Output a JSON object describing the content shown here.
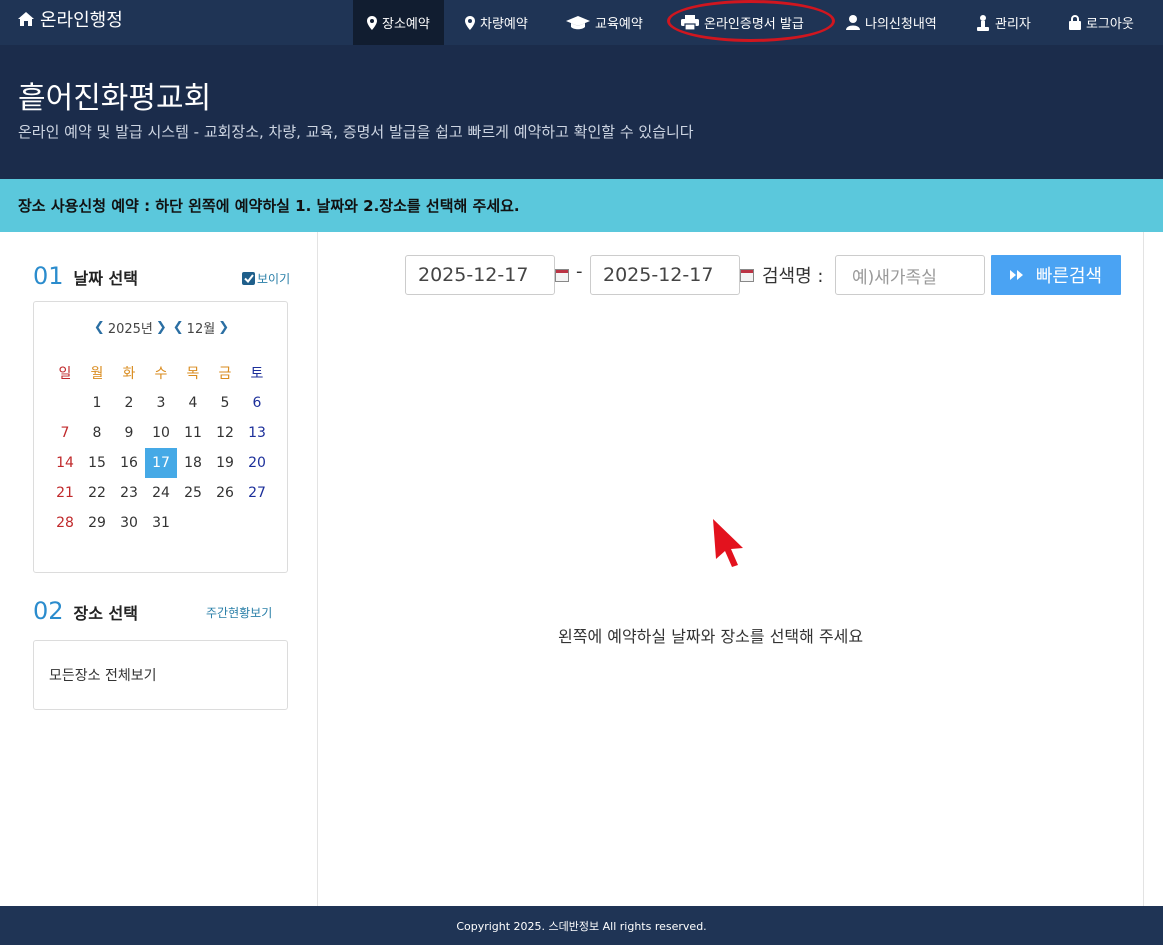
{
  "nav": {
    "brand": "온라인행정",
    "items": [
      {
        "label": "장소예약",
        "icon": "map-marker-icon"
      },
      {
        "label": "차량예약",
        "icon": "map-marker-icon"
      },
      {
        "label": "교육예약",
        "icon": "graduation-cap-icon"
      },
      {
        "label": "온라인증명서 발급",
        "icon": "printer-icon"
      },
      {
        "label": "나의신청내역",
        "icon": "user-icon"
      },
      {
        "label": "관리자",
        "icon": "admin-icon"
      },
      {
        "label": "로그아웃",
        "icon": "lock-icon"
      }
    ],
    "active_index": 0,
    "highlighted_index": 3,
    "highlight_color": "#d0161f"
  },
  "hero": {
    "title": "흩어진화평교회",
    "subtitle": "온라인 예약 및 발급 시스템 - 교회장소, 차량, 교육, 증명서 발급을 쉽고 빠르게 예약하고 확인할 수 있습니다"
  },
  "notice": "장소 사용신청 예약 : 하단 왼쪽에 예약하실 1. 날짜와 2.장소를 선택해 주세요.",
  "date_section": {
    "number": "01",
    "title": "날짜 선택",
    "toggle_label": "보이기",
    "toggle_checked": true
  },
  "calendar": {
    "year_label": "2025년",
    "month_label": "12월",
    "weekdays": [
      "일",
      "월",
      "화",
      "수",
      "목",
      "금",
      "토"
    ],
    "weeks": [
      [
        "",
        "1",
        "2",
        "3",
        "4",
        "5",
        "6"
      ],
      [
        "7",
        "8",
        "9",
        "10",
        "11",
        "12",
        "13"
      ],
      [
        "14",
        "15",
        "16",
        "17",
        "18",
        "19",
        "20"
      ],
      [
        "21",
        "22",
        "23",
        "24",
        "25",
        "26",
        "27"
      ],
      [
        "28",
        "29",
        "30",
        "31",
        "",
        "",
        ""
      ]
    ],
    "selected_day": "17"
  },
  "place_section": {
    "number": "02",
    "title": "장소 선택",
    "link_label": "주간현황보기",
    "all_places_label": "모든장소 전체보기"
  },
  "search": {
    "start_date": "2025-12-17",
    "separator": "-",
    "end_date": "2025-12-17",
    "name_label": "검색명 :",
    "placeholder": "예)새가족실",
    "button_label": "빠른검색"
  },
  "empty_message": "왼쪽에 예약하실 날짜와 장소를 선택해 주세요",
  "footer": "Copyright 2025. 스데반정보 All rights reserved.",
  "colors": {
    "nav_bg": "#1f3455",
    "hero_bg": "#1b2c4b",
    "notice_bg": "#5bc8dc",
    "accent": "#4aa3f3",
    "selected_day": "#45a9e6"
  }
}
